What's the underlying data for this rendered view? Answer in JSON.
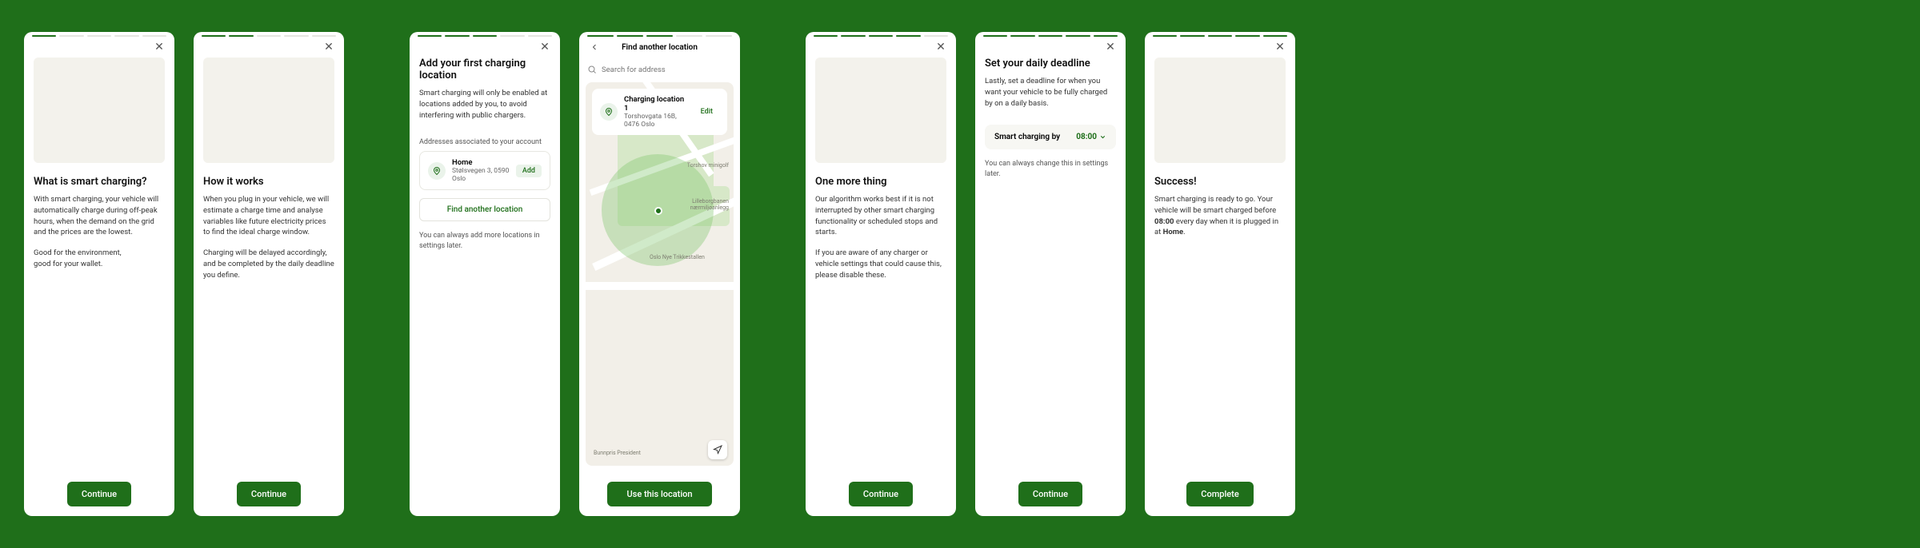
{
  "screens": {
    "s1": {
      "heading": "What is smart charging?",
      "para1": "With smart charging, your vehicle will automatically charge during off-peak hours, when the demand on the grid and the prices are the lowest.",
      "para2": "Good for the environment,\ngood for your wallet.",
      "continue": "Continue"
    },
    "s2": {
      "heading": "How it works",
      "para1": "When you plug in your vehicle, we will estimate a charge time and analyse variables like future electricity prices to find the ideal charge window.",
      "para2": "Charging will be delayed accordingly, and be completed by the daily deadline you define.",
      "continue": "Continue"
    },
    "s3": {
      "heading": "Add your first charging location",
      "para1": "Smart charging will only be enabled at locations added by you, to avoid interfering with public chargers.",
      "assoc": "Addresses associated to your account",
      "addr_title": "Home",
      "addr_sub": "Stølsvegen 3, 0590 Oslo",
      "add": "Add",
      "find": "Find another location",
      "hint": "You can always add more locations in settings later."
    },
    "s4": {
      "barTitle": "Find another location",
      "search_placeholder": "Search for address",
      "card_title": "Charging location 1",
      "card_sub": "Torshovgata 16B, 0476 Oslo",
      "edit": "Edit",
      "use": "Use this location",
      "map_labels": {
        "a": "Torshov minigolf",
        "b": "Lilleborgbanen nærmiljøanlegg",
        "c": "Oslo Nye Trikkestallen",
        "d": "Bunnpris President"
      }
    },
    "s5": {
      "heading": "One more thing",
      "para1": "Our algorithm works best if it is not interrupted by other smart charging functionality or scheduled stops and starts.",
      "para2": "If you are aware of any charger or vehicle settings that could cause this, please disable these.",
      "continue": "Continue"
    },
    "s6": {
      "heading": "Set your daily deadline",
      "para1": "Lastly, set a deadline for when you want your vehicle to be fully charged by on a daily basis.",
      "time_label": "Smart charging by",
      "time_value": "08:00",
      "hint": "You can always change this in settings later.",
      "continue": "Continue"
    },
    "s7": {
      "heading": "Success!",
      "para_pre": "Smart charging is ready to go. Your vehicle will be smart charged before ",
      "para_bold1": "08:00",
      "para_mid": " every day when it is plugged in at ",
      "para_bold2": "Home",
      "para_end": ".",
      "complete": "Complete"
    }
  }
}
